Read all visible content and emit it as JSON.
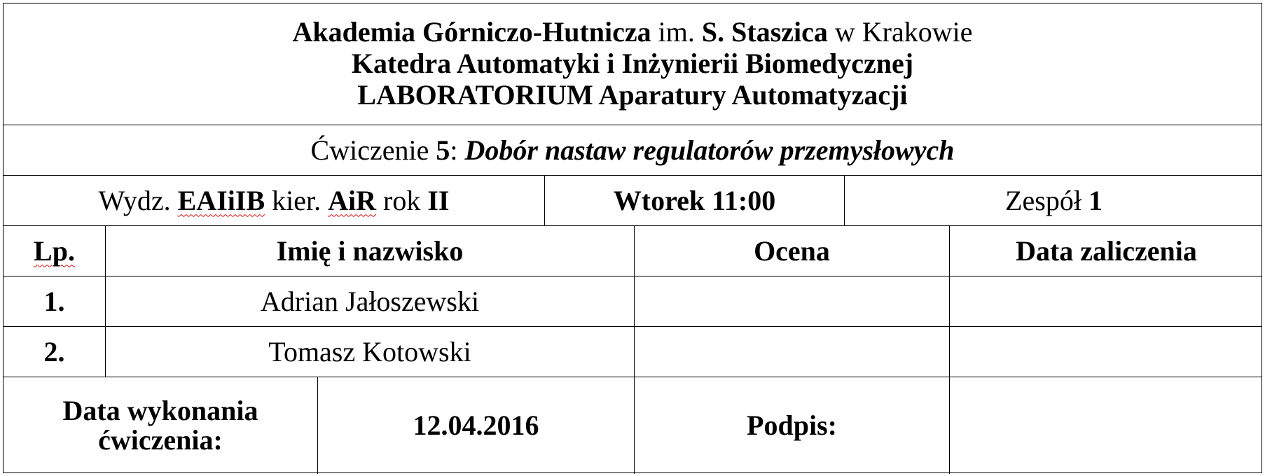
{
  "header": {
    "line1": {
      "a": "Akademia Górniczo-Hutnicza",
      "b": " im. ",
      "c": "S. Staszica",
      "d": " w Krakowie"
    },
    "line2": "Katedra Automatyki i Inżynierii Biomedycznej",
    "line3": "LABORATORIUM Aparatury Automatyzacji"
  },
  "exercise": {
    "prefix": "Ćwiczenie ",
    "number": "5",
    "colon": ": ",
    "title": "Dobór nastaw regulatorów przemysłowych"
  },
  "info": {
    "wydz_label": "Wydz. ",
    "wydz_value": "EAIiIB",
    "kier_label": " kier. ",
    "kier_value": "AiR",
    "rok_label": " rok ",
    "rok_value": "II",
    "schedule": "Wtorek 11:00",
    "team_label": "Zespół ",
    "team_value": "1"
  },
  "table": {
    "headers": [
      "Lp.",
      "Imię i nazwisko",
      "Ocena",
      "Data zaliczenia"
    ],
    "rows": [
      {
        "lp": "1.",
        "name": "Adrian Jałoszewski",
        "grade": "",
        "date": ""
      },
      {
        "lp": "2.",
        "name": "Tomasz Kotowski",
        "grade": "",
        "date": ""
      }
    ]
  },
  "footer": {
    "date_label_line1": "Data wykonania",
    "date_label_line2": "ćwiczenia:",
    "date_value": "12.04.2016",
    "signature_label": "Podpis:",
    "signature_value": ""
  }
}
